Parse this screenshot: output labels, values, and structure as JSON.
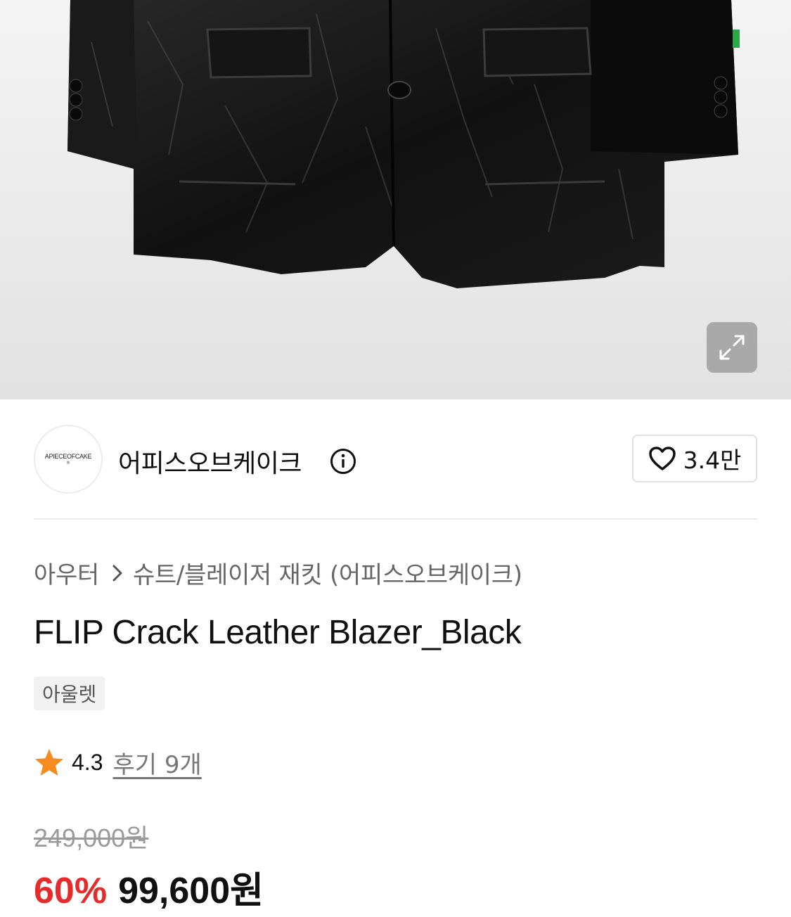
{
  "hero": {
    "expand_icon": "expand-arrows-icon"
  },
  "brand": {
    "logo_text": "APIECEOFCAKE",
    "logo_mark": "®",
    "name": "어피스오브케이크",
    "info_icon": "info-circle-icon"
  },
  "like": {
    "icon": "heart-outline-icon",
    "count": "3.4만"
  },
  "breadcrumb": {
    "items": [
      "아우터",
      "슈트/블레이저 재킷 (어피스오브케이크)"
    ],
    "separator_icon": "chevron-right-icon"
  },
  "product": {
    "title": "FLIP Crack Leather Blazer_Black",
    "badge": "아울렛"
  },
  "rating": {
    "icon": "star-icon",
    "star_color": "#f68b1f",
    "value": "4.3",
    "reviews_label": "후기 9개"
  },
  "price": {
    "original": "249,000원",
    "discount": "60%",
    "sale": "99,600원",
    "discount_color": "#e52b2b"
  }
}
